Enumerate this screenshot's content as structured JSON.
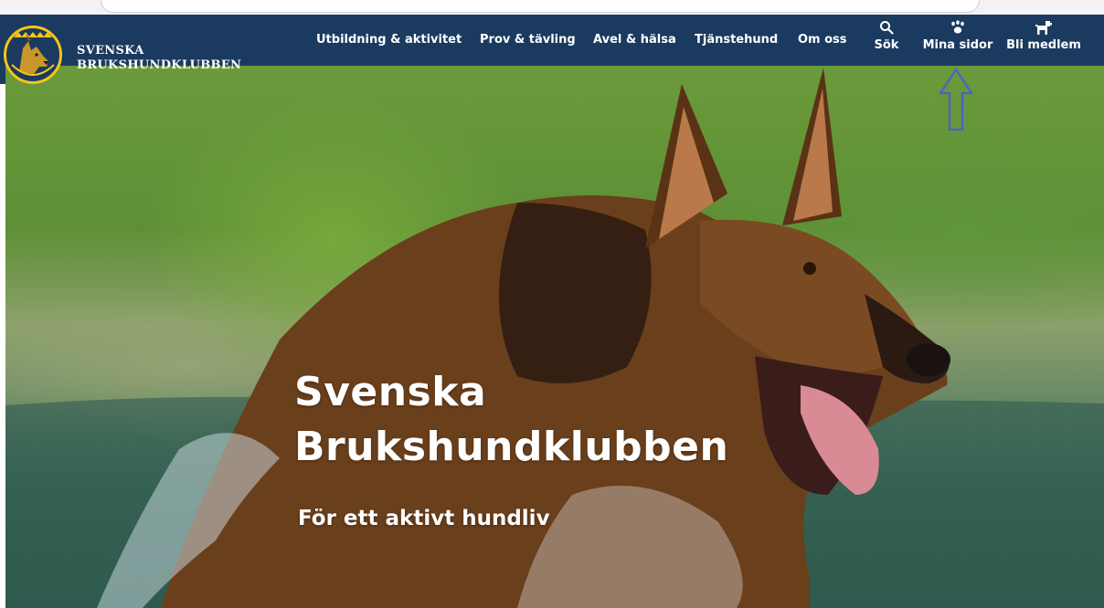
{
  "brand": {
    "line1": "SVENSKA",
    "line2": "BRUKSHUNDKLUBBEN",
    "logo_icon": "dog-head-emblem-icon",
    "logo_text": "BRUKSHUNDKLUBBEN"
  },
  "nav": {
    "items": [
      {
        "label": "Utbildning & aktivitet"
      },
      {
        "label": "Prov & tävling"
      },
      {
        "label": "Avel & hälsa"
      },
      {
        "label": "Tjänstehund"
      },
      {
        "label": "Om oss"
      }
    ],
    "search": {
      "label": "Sök",
      "icon": "search-icon"
    },
    "my_pages": {
      "label": "Mina sidor",
      "icon": "paw-icon"
    },
    "join": {
      "label": "Bli medlem",
      "icon": "dog-icon"
    }
  },
  "hero": {
    "title_line1": "Svenska",
    "title_line2": "Brukshundklubben",
    "subtitle": "För ett aktivt hundliv"
  },
  "colors": {
    "navbar": "#1b3a5f",
    "logo_ring": "#f5c518",
    "annotation_arrow": "#4a5fd0"
  }
}
